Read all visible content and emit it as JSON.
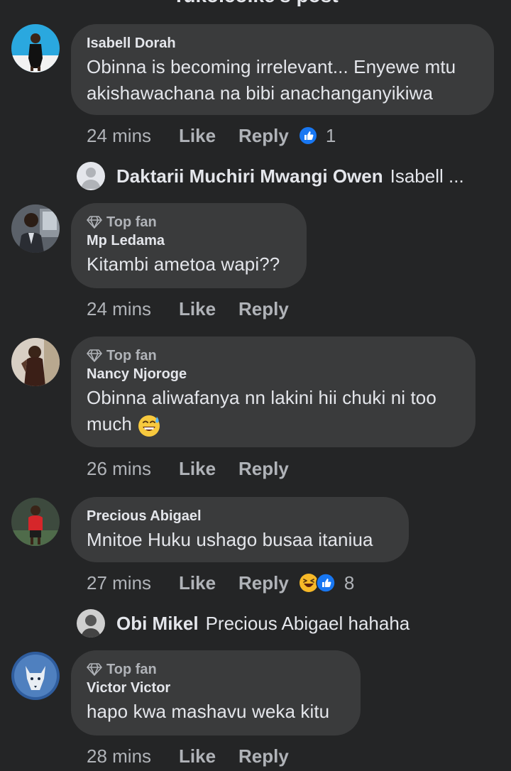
{
  "header": {
    "partial_title": "Tuko.co.ke's post"
  },
  "comments": [
    {
      "author": "Isabell Dorah",
      "badge": "",
      "text": "Obinna is becoming irrelevant... Enyewe mtu akishawachana na bibi anachanganyikiwa",
      "time": "24 mins",
      "like_label": "Like",
      "reply_label": "Reply",
      "reactions": [
        "like-reaction-icon"
      ],
      "reaction_count": "1",
      "reply_preview": {
        "author": "Daktarii Muchiri Mwangi Owen",
        "text": "Isabell ..."
      }
    },
    {
      "author": "Mp Ledama",
      "badge": "Top fan",
      "text": "Kitambi ametoa wapi??",
      "time": "24 mins",
      "like_label": "Like",
      "reply_label": "Reply"
    },
    {
      "author": "Nancy Njoroge",
      "badge": "Top fan",
      "text": "Obinna aliwafanya nn lakini hii chuki ni too much",
      "time": "26 mins",
      "like_label": "Like",
      "reply_label": "Reply"
    },
    {
      "author": "Precious Abigael",
      "badge": "",
      "text": "Mnitoe Huku ushago busaa itaniua",
      "time": "27 mins",
      "like_label": "Like",
      "reply_label": "Reply",
      "reactions": [
        "haha-reaction-icon",
        "like-reaction-icon"
      ],
      "reaction_count": "8",
      "reply_preview": {
        "author": "Obi Mikel",
        "text": "Precious Abigael hahaha"
      }
    },
    {
      "author": "Victor Victor",
      "badge": "Top fan",
      "text": "hapo kwa mashavu weka kitu",
      "time": "28 mins",
      "like_label": "Like",
      "reply_label": "Reply"
    }
  ],
  "colors": {
    "background": "#242526",
    "bubble": "#3a3b3c",
    "primary_text": "#e4e6eb",
    "secondary_text": "#b0b3b8",
    "like_blue": "#1877f2",
    "haha_yellow": "#f7b928"
  }
}
